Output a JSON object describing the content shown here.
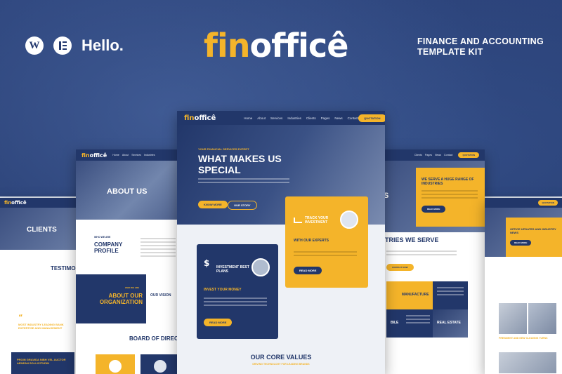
{
  "header": {
    "wordpress_label": "W",
    "hello_label": "Hello.",
    "brand_fin": "fin",
    "brand_office": "officê",
    "tagline": "FINANCE AND ACCOUNTING TEMPLATE KIT"
  },
  "nav": {
    "logo_fin": "fin",
    "logo_office": "officê",
    "links": [
      "Home",
      "About",
      "Services",
      "Industries",
      "Clients",
      "Pages",
      "News",
      "Contact"
    ],
    "cta": "QUOTATION"
  },
  "center": {
    "kicker": "YOUR FINANCIAL SERVICES EXPERT",
    "title_1": "WHAT MAKES US",
    "title_2": "SPECIAL",
    "btn_more": "KNOW MORE",
    "btn_story": "OUR STORY",
    "card_track_title": "TRACK YOUR INVESTMENT",
    "card_track_sub": "WITH OUR EXPERTS",
    "card_track_btn": "READ MORE",
    "card_invest_title": "INVESTMENT BEST PLANS",
    "card_invest_sub": "INVEST YOUR MONEY",
    "card_invest_btn": "READ MORE",
    "values_title": "OUR CORE VALUES",
    "values_sub": "DRIVING TECHNOLOGY FOR LEADING BRANDS"
  },
  "left": {
    "about_title": "ABOUT US",
    "who_label": "WHO WE ARE",
    "company_profile": "COMPANY PROFILE",
    "org_kicker": "WHO WE ARE",
    "org_title": "ABOUT OUR ORGANIZATION",
    "vision": "OUR VISION",
    "board": "BOARD OF DIREC",
    "clients_title": "CLIENTS",
    "testimonial": "TESTIMONI",
    "quote_text": "MOST INDUSTRY LEADING BANK EXPERTISE AND MANAGEMENT",
    "dark_quote": "PROIN GRAVIDA NIBH VEL AUCTOR AENEAN SOLLICITUDIN"
  },
  "right": {
    "serve_title": "WE SERVE A HUGE RANGE OF INDUSTRIES",
    "serve_btn": "READ MORE",
    "partial_title": "S",
    "industries": "TRIES WE SERVE",
    "contact_btn": "CONTACT NOW",
    "tile_manufacture": "MANUFACTURE",
    "tile_mobile": "BILE",
    "tile_real_estate": "REAL ESTATE",
    "office_updates": "OFFICE UPDATES AND INDUSTRY NEWS",
    "office_btn": "READ MORE",
    "news_card": "PRESIDENT AND NEW CLEAVING TURNS"
  },
  "colors": {
    "navy": "#22376a",
    "yellow": "#f4b42a"
  }
}
